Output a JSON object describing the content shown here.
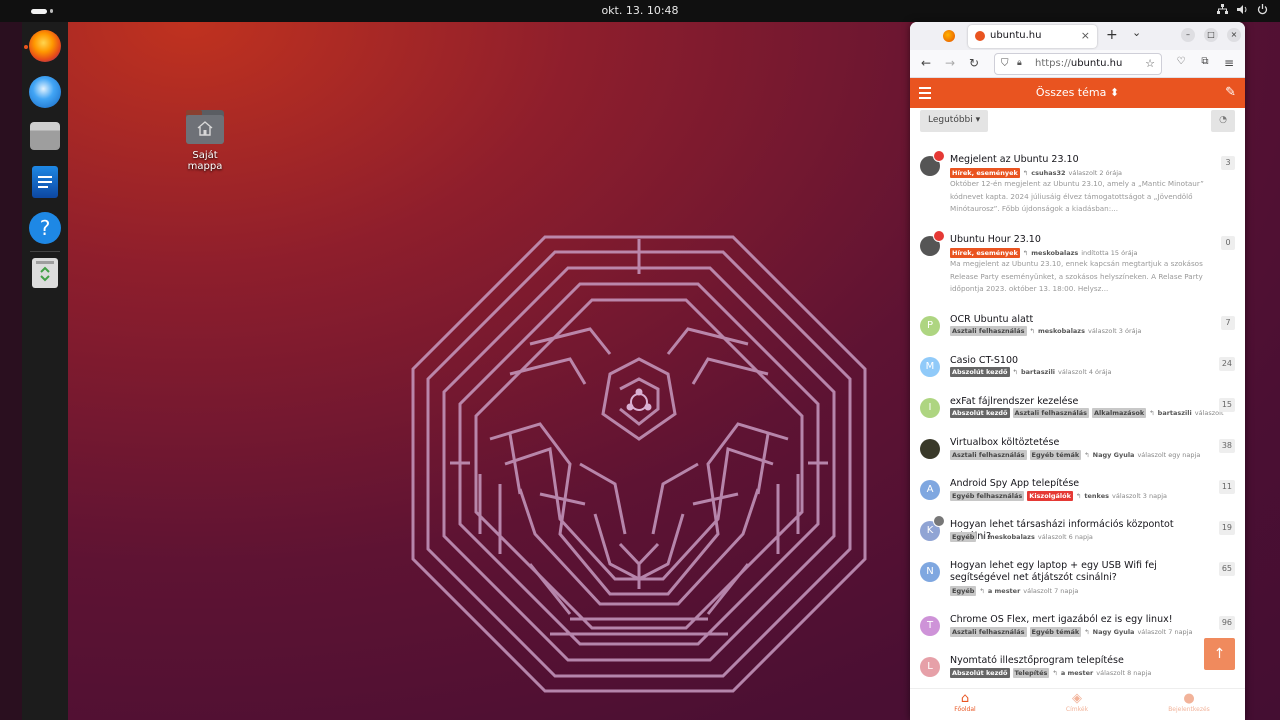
{
  "topbar": {
    "clock": "okt. 13.  10:48"
  },
  "desktop": {
    "home_folder_label": "Saját mappa"
  },
  "dock": {
    "apps": [
      "Firefox",
      "Thunderbird",
      "Files",
      "LibreOffice Writer",
      "Help",
      "Trash"
    ]
  },
  "browser": {
    "tab_title": "ubuntu.hu",
    "tab_close": "×",
    "new_tab": "+",
    "url_proto": "https://",
    "url_host": "ubuntu.hu"
  },
  "site": {
    "heading": "Összes téma ⬍",
    "sort_label": "Legutóbbi ▾",
    "topics": [
      {
        "title": "Megjelent az Ubuntu 23.10",
        "tags": [
          "Hírek, események"
        ],
        "user": "csuhas32",
        "action": "válaszolt 2 órája",
        "count": "3",
        "excerpt": "Október 12-én megjelent az Ubuntu 23.10, amely a „Mantic Minotaur” kódnevet kapta. 2024 júliusáig élvez támogatottságot a „Jövendölő Minótaurosz”. Főbb újdonságok a kiadásban:..."
      },
      {
        "title": "Ubuntu Hour 23.10",
        "tags": [
          "Hírek, események"
        ],
        "user": "meskobalazs",
        "action": "indította 15 órája",
        "count": "0",
        "excerpt": "Ma megjelent az Ubuntu 23.10, ennek kapcsán megtartjuk a szokásos Release Party eseményünket, a szokásos helyszíneken. A Relase Party időpontja 2023. október 13. 18:00. Helysz..."
      },
      {
        "title": "OCR Ubuntu alatt",
        "tags": [
          "Asztali felhasználás"
        ],
        "user": "meskobalazs",
        "action": "válaszolt 3 órája",
        "count": "7",
        "avatar": "P",
        "color": "#aed581"
      },
      {
        "title": "Casio CT-S100",
        "tags": [
          "Abszolút kezdő"
        ],
        "user": "bartaszili",
        "action": "válaszolt 4 órája",
        "count": "24",
        "avatar": "M",
        "color": "#90caf9"
      },
      {
        "title": "exFat fájlrendszer kezelése",
        "tags": [
          "Abszolút kezdő",
          "Asztali felhasználás",
          "Alkalmazások"
        ],
        "user": "bartaszili",
        "action": "válaszolt 5 ór...",
        "count": "15",
        "avatar": "I",
        "color": "#aed581"
      },
      {
        "title": "Virtualbox költöztetése",
        "tags": [
          "Asztali felhasználás",
          "Egyéb témák"
        ],
        "user": "Nagy Gyula",
        "action": "válaszolt egy napja",
        "count": "38"
      },
      {
        "title": "Android Spy App telepítése",
        "tags": [
          "Egyéb felhasználás",
          "Kiszolgálók"
        ],
        "user": "tenkes",
        "action": "válaszolt 3 napja",
        "count": "11",
        "avatar": "A",
        "color": "#7fa7e0"
      },
      {
        "title": "Hogyan lehet társasházi információs központot csinálni?",
        "tags": [
          "Egyéb"
        ],
        "user": "meskobalazs",
        "action": "válaszolt 6 napja",
        "count": "19",
        "avatar": "K",
        "color": "#90a4d4"
      },
      {
        "title": "Hogyan lehet egy laptop + egy USB Wifi fej segítségével net átjátszót csinálni?",
        "tags": [
          "Egyéb"
        ],
        "user": "a mester",
        "action": "válaszolt 7 napja",
        "count": "65",
        "avatar": "N",
        "color": "#7fa7e0"
      },
      {
        "title": "Chrome OS Flex, mert igazából ez is egy linux!",
        "tags": [
          "Asztali felhasználás",
          "Egyéb témák"
        ],
        "user": "Nagy Gyula",
        "action": "válaszolt 7 napja",
        "count": "96",
        "avatar": "T",
        "color": "#ce93d8"
      },
      {
        "title": "Nyomtató illesztőprogram telepítése",
        "tags": [
          "Abszolút kezdő",
          "Telepítés"
        ],
        "user": "a mester",
        "action": "válaszolt 8 napja",
        "count": "",
        "avatar": "L",
        "color": "#e6a0a8"
      }
    ],
    "bottom_nav": [
      "Főoldal",
      "Címkék",
      "Bejelentkezés"
    ]
  },
  "colors": {
    "accent": "#e95420",
    "dock": "#1c1c1c",
    "topbar": "#101010"
  }
}
